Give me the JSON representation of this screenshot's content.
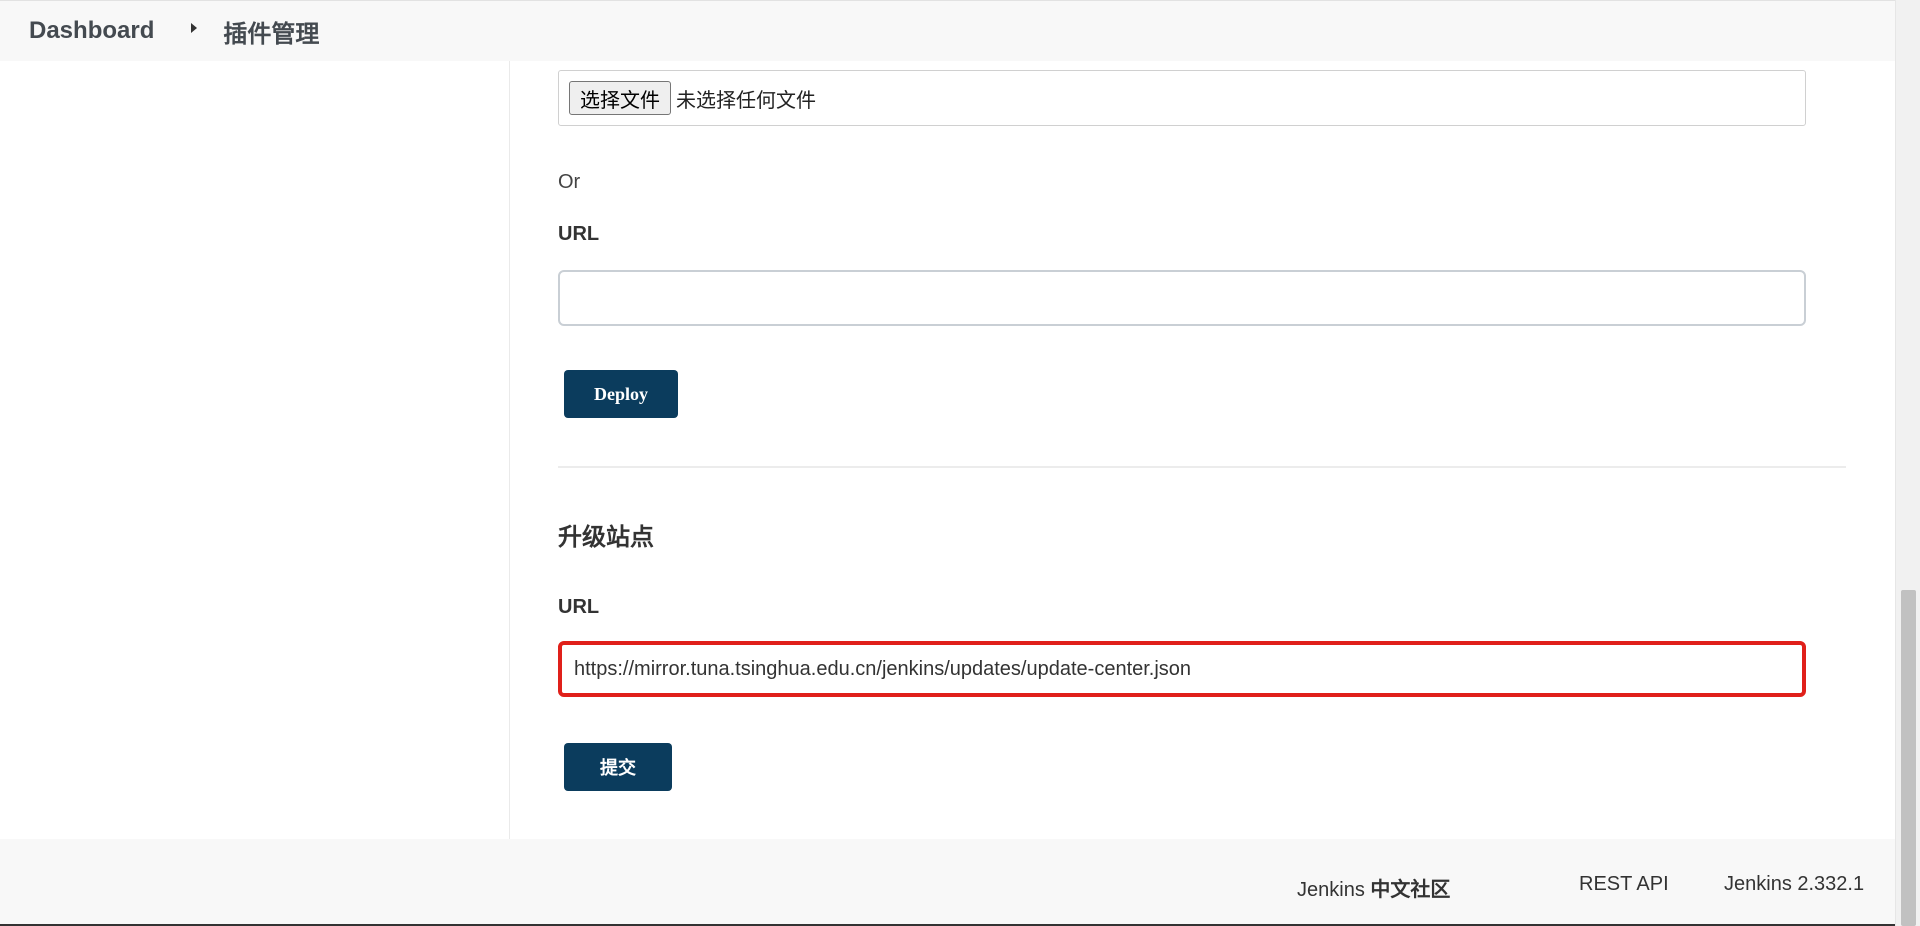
{
  "breadcrumb": {
    "items": [
      {
        "label": "Dashboard"
      },
      {
        "label": "插件管理"
      }
    ]
  },
  "upload": {
    "file_button_label": "选择文件",
    "file_status": "未选择任何文件",
    "or_label": "Or",
    "url_label": "URL",
    "url_value": "",
    "deploy_label": "Deploy"
  },
  "update_site": {
    "title": "升级站点",
    "url_label": "URL",
    "url_value": "https://mirror.tuna.tsinghua.edu.cn/jenkins/updates/update-center.json",
    "submit_label": "提交",
    "highlight_color": "#e0201a"
  },
  "footer": {
    "community_prefix": "Jenkins ",
    "community_bold": "中文社区",
    "rest_api": "REST API",
    "version": "Jenkins 2.332.1"
  },
  "colors": {
    "primary_button": "#0b3c5d",
    "bar_background": "#f8f8f8"
  }
}
